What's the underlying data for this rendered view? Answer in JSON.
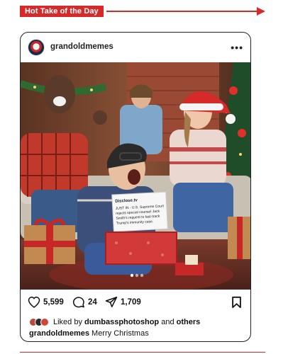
{
  "banner": {
    "title": "Hot Take of the Day",
    "color": "#d62a2a"
  },
  "post": {
    "username": "grandoldmemes",
    "more_icon": "more-horizontal-icon",
    "image": {
      "alt": "Christmas living room scene",
      "doc_header": "Disclose.tv",
      "doc_text_1": "JUST IN - U.S. Supreme Court",
      "doc_text_2": "rejects special counsel Jack",
      "doc_text_3": "Smith's request to fast-track",
      "doc_text_4": "Trump's immunity case."
    },
    "carousel_dots": 3,
    "actions": {
      "likes_count": "5,599",
      "comments_count": "24",
      "shares_count": "1,709"
    },
    "liked_by": {
      "prefix": "Liked by",
      "user": "dumbassphotoshop",
      "and": "and",
      "others": "others"
    },
    "caption": {
      "user": "grandoldmemes",
      "text": "Merry Christmas"
    }
  }
}
